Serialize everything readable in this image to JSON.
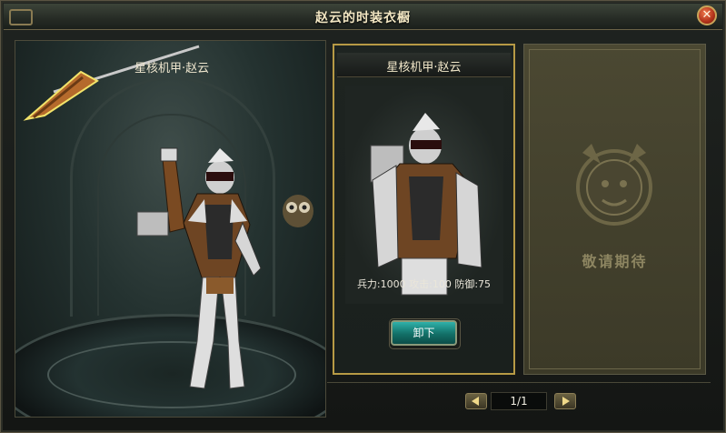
{
  "window": {
    "title": "赵云的时装衣橱",
    "close_glyph": "✕"
  },
  "preview": {
    "costume_name": "星核机甲·赵云"
  },
  "costume_card": {
    "name": "星核机甲·赵云",
    "stats": "兵力:1000 攻击:100 防御:75",
    "unequip_label": "卸下"
  },
  "locked_slot": {
    "text": "敬请期待"
  },
  "pager": {
    "page_text": "1/1"
  },
  "colors": {
    "card_border": "#b79a45",
    "button_teal": "#1f8f88",
    "title_text": "#f3e7c3"
  }
}
